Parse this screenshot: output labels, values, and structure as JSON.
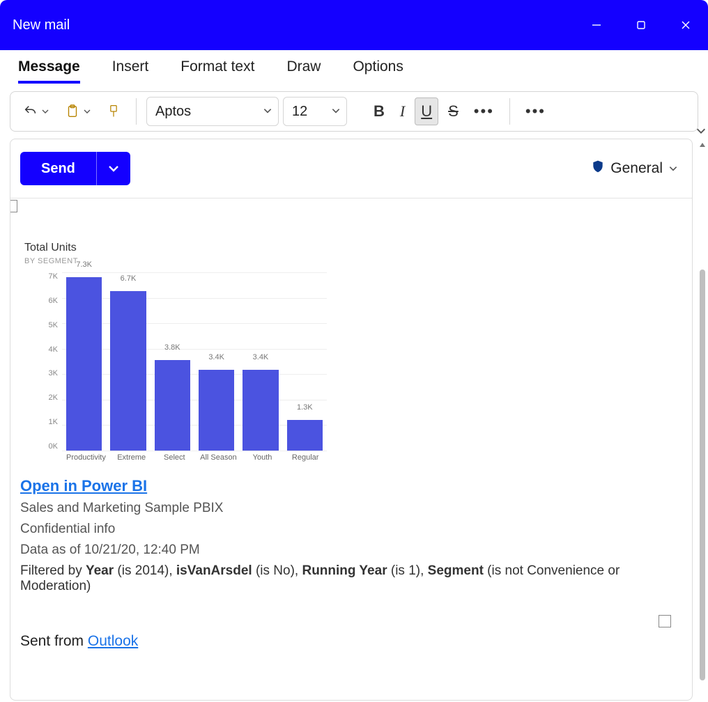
{
  "window": {
    "title": "New mail"
  },
  "tabs": {
    "items": [
      "Message",
      "Insert",
      "Format text",
      "Draw",
      "Options"
    ],
    "active_index": 0
  },
  "toolbar": {
    "font_name": "Aptos",
    "font_size": "12",
    "bold_active": false,
    "italic_active": false,
    "underline_active": true,
    "strike_active": false
  },
  "compose": {
    "send_label": "Send",
    "sensitivity_label": "General"
  },
  "body": {
    "link_label": "Open in Power BI",
    "report_name": "Sales and Marketing Sample PBIX",
    "confidential": "Confidential info",
    "data_as_of": "Data as of 10/21/20, 12:40 PM",
    "filter_prefix": "Filtered by ",
    "filters": [
      {
        "field": "Year",
        "predicate": " (is 2014), "
      },
      {
        "field": "isVanArsdel",
        "predicate": " (is No), "
      },
      {
        "field": "Running Year",
        "predicate": " (is 1), "
      },
      {
        "field": "Segment",
        "predicate": " (is not Convenience or Moderation)"
      }
    ],
    "signature_prefix": "Sent from ",
    "signature_link": "Outlook"
  },
  "chart_data": {
    "type": "bar",
    "title": "Total Units",
    "subtitle": "BY SEGMENT",
    "ylabel": "",
    "xlabel": "",
    "ylim": [
      0,
      7500
    ],
    "y_ticks": [
      "7K",
      "6K",
      "5K",
      "4K",
      "3K",
      "2K",
      "1K",
      "0K"
    ],
    "categories": [
      "Productivity",
      "Extreme",
      "Select",
      "All Season",
      "Youth",
      "Regular"
    ],
    "values": [
      7300,
      6700,
      3800,
      3400,
      3400,
      1300
    ],
    "value_labels": [
      "7.3K",
      "6.7K",
      "3.8K",
      "3.4K",
      "3.4K",
      "1.3K"
    ],
    "bar_color": "#4b53e0"
  }
}
